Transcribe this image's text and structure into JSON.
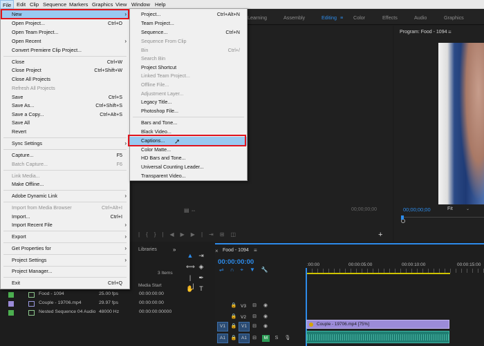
{
  "menubar": {
    "items": [
      "File",
      "Edit",
      "Clip",
      "Sequence",
      "Markers",
      "Graphics",
      "View",
      "Window",
      "Help"
    ]
  },
  "workspaces": [
    "Learning",
    "Assembly",
    "Editing",
    "Color",
    "Effects",
    "Audio",
    "Graphics"
  ],
  "active_workspace": "Editing",
  "program_monitor": {
    "title": "Program: Food - 1094",
    "timecode": "00;00;00;00",
    "fit": "Fit"
  },
  "source_monitor": {
    "timecode": "00;00;00;00"
  },
  "project_panel": {
    "tab": "Libraries",
    "item_count": "3 Items",
    "col_media_start": "Media Start",
    "rows": [
      {
        "name": "Food - 1094",
        "fps": "25.00 fps",
        "start": "00:00:00:00",
        "color": "#4caf50"
      },
      {
        "name": "Couple - 19706.mp4",
        "fps": "29.97 fps",
        "start": "00:00:00:00",
        "color": "#9b8bd8"
      },
      {
        "name": "Nested Sequence 04 Audio",
        "fps": "48000 Hz",
        "start": "00:00:00:00000",
        "color": "#4caf50"
      }
    ]
  },
  "timeline": {
    "title": "Food - 1094",
    "timecode": "00:00:00:00",
    "ruler": [
      ":00:00",
      "00:00:05:00",
      "00:00:10:00",
      "00:00:15:00"
    ],
    "tracks": {
      "v3": "V3",
      "v2": "V2",
      "v1": "V1",
      "a1": "A1",
      "v1_src": "V1",
      "a1_src": "A1",
      "m": "M",
      "s": "S"
    },
    "video_clip": "Couple - 19706.mp4 [75%]"
  },
  "file_menu": {
    "items": [
      {
        "label": "New",
        "arrow": true
      },
      {
        "label": "Open Project...",
        "shortcut": "Ctrl+O"
      },
      {
        "label": "Open Team Project..."
      },
      {
        "label": "Open Recent",
        "arrow": true
      },
      {
        "label": "Convert Premiere Clip Project..."
      },
      {
        "label": "Close",
        "shortcut": "Ctrl+W"
      },
      {
        "label": "Close Project",
        "shortcut": "Ctrl+Shift+W"
      },
      {
        "label": "Close All Projects"
      },
      {
        "label": "Refresh All Projects",
        "disabled": true
      },
      {
        "label": "Save",
        "shortcut": "Ctrl+S"
      },
      {
        "label": "Save As...",
        "shortcut": "Ctrl+Shift+S"
      },
      {
        "label": "Save a Copy...",
        "shortcut": "Ctrl+Alt+S"
      },
      {
        "label": "Save All"
      },
      {
        "label": "Revert"
      },
      {
        "label": "Sync Settings",
        "arrow": true
      },
      {
        "label": "Capture...",
        "shortcut": "F5"
      },
      {
        "label": "Batch Capture...",
        "shortcut": "F6",
        "disabled": true
      },
      {
        "label": "Link Media...",
        "disabled": true
      },
      {
        "label": "Make Offline..."
      },
      {
        "label": "Adobe Dynamic Link",
        "arrow": true
      },
      {
        "label": "Import from Media Browser",
        "shortcut": "Ctrl+Alt+I",
        "disabled": true
      },
      {
        "label": "Import...",
        "shortcut": "Ctrl+I"
      },
      {
        "label": "Import Recent File",
        "arrow": true
      },
      {
        "label": "Export",
        "arrow": true
      },
      {
        "label": "Get Properties for",
        "arrow": true
      },
      {
        "label": "Project Settings",
        "arrow": true
      },
      {
        "label": "Project Manager..."
      },
      {
        "label": "Exit",
        "shortcut": "Ctrl+Q"
      }
    ]
  },
  "new_menu": {
    "items": [
      {
        "label": "Project...",
        "shortcut": "Ctrl+Alt+N"
      },
      {
        "label": "Team Project..."
      },
      {
        "label": "Sequence...",
        "shortcut": "Ctrl+N"
      },
      {
        "label": "Sequence From Clip",
        "disabled": true
      },
      {
        "label": "Bin",
        "shortcut": "Ctrl+/",
        "disabled": true
      },
      {
        "label": "Search Bin",
        "disabled": true
      },
      {
        "label": "Project Shortcut"
      },
      {
        "label": "Linked Team Project...",
        "disabled": true
      },
      {
        "label": "Offline File...",
        "disabled": true
      },
      {
        "label": "Adjustment Layer...",
        "disabled": true
      },
      {
        "label": "Legacy Title..."
      },
      {
        "label": "Photoshop File..."
      },
      {
        "label": "Bars and Tone..."
      },
      {
        "label": "Black Video..."
      },
      {
        "label": "Captions..."
      },
      {
        "label": "Color Matte..."
      },
      {
        "label": "HD Bars and Tone..."
      },
      {
        "label": "Universal Counting Leader..."
      },
      {
        "label": "Transparent Video..."
      }
    ]
  },
  "colors": {
    "accent": "#2d8ceb",
    "highlight_box": "#e0141e",
    "hover": "#99c9f1"
  }
}
